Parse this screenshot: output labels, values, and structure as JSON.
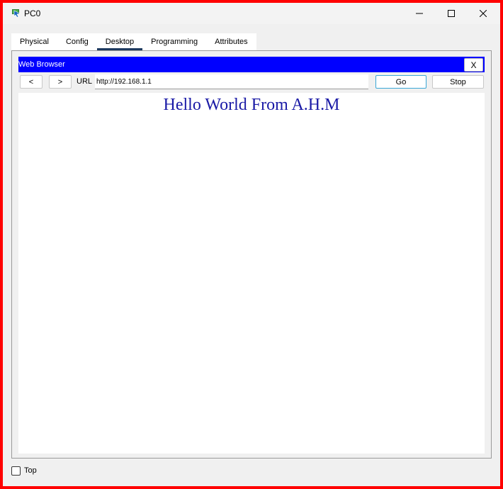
{
  "window": {
    "title": "PC0",
    "icon": "pc-app-icon"
  },
  "tabs": [
    {
      "label": "Physical",
      "active": false
    },
    {
      "label": "Config",
      "active": false
    },
    {
      "label": "Desktop",
      "active": true
    },
    {
      "label": "Programming",
      "active": false
    },
    {
      "label": "Attributes",
      "active": false
    }
  ],
  "browser": {
    "title": "Web Browser",
    "close_label": "X",
    "back_label": "<",
    "forward_label": ">",
    "url_label": "URL",
    "url_value": "http://192.168.1.1",
    "go_label": "Go",
    "stop_label": "Stop",
    "title_bar_color": "#0000ff"
  },
  "page": {
    "heading": "Hello World From A.H.M",
    "heading_color": "#1a1aa6"
  },
  "footer": {
    "top_label": "Top",
    "top_checked": false
  }
}
